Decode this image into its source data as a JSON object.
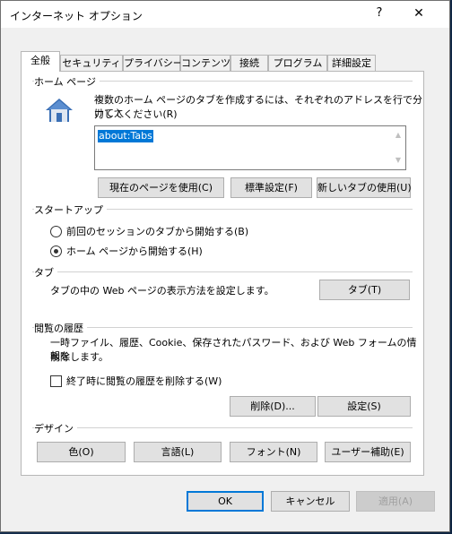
{
  "window": {
    "title": "インターネット オプション",
    "help_label": "?",
    "close_label": "✕"
  },
  "tabs": [
    {
      "label": "全般",
      "active": true
    },
    {
      "label": "セキュリティ"
    },
    {
      "label": "プライバシー"
    },
    {
      "label": "コンテンツ"
    },
    {
      "label": "接続"
    },
    {
      "label": "プログラム"
    },
    {
      "label": "詳細設定"
    }
  ],
  "homepage": {
    "group_label": "ホーム ページ",
    "description_line1": "複数のホーム ページのタブを作成するには、それぞれのアドレスを行で分けて入",
    "description_line2": "力してください(R)",
    "url_value": "about:Tabs",
    "buttons": {
      "use_current": "現在のページを使用(C)",
      "use_default": "標準設定(F)",
      "use_new_tab": "新しいタブの使用(U)"
    },
    "icon": "house-icon"
  },
  "startup": {
    "group_label": "スタートアップ",
    "option_previous": "前回のセッションのタブから開始する(B)",
    "option_homepage": "ホーム ページから開始する(H)",
    "selected": "homepage"
  },
  "tabs_group": {
    "group_label": "タブ",
    "description": "タブの中の Web ページの表示方法を設定します。",
    "button": "タブ(T)"
  },
  "history": {
    "group_label": "閲覧の履歴",
    "description_line1": "一時ファイル、履歴、Cookie、保存されたパスワード、および Web フォームの情報を",
    "description_line2": "削除します。",
    "checkbox_label": "終了時に閲覧の履歴を削除する(W)",
    "checked": false,
    "delete_button": "削除(D)...",
    "settings_button": "設定(S)"
  },
  "design": {
    "group_label": "デザイン",
    "colors_button": "色(O)",
    "languages_button": "言語(L)",
    "fonts_button": "フォント(N)",
    "accessibility_button": "ユーザー補助(E)"
  },
  "footer": {
    "ok": "OK",
    "cancel": "キャンセル",
    "apply": "適用(A)"
  },
  "colors": {
    "accent": "#0078d7",
    "house_roof": "#3a6fb5",
    "house_body": "#dfe7f1"
  }
}
